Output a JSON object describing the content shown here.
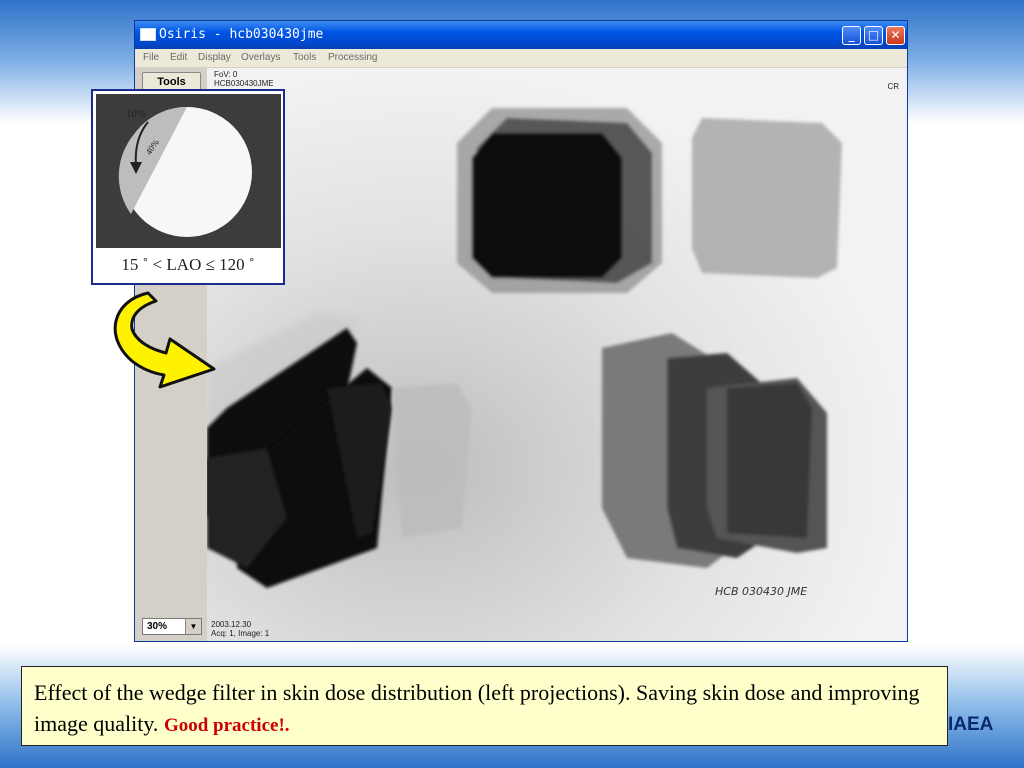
{
  "window": {
    "title": "Osiris - hcb030430jme",
    "menu": [
      "File",
      "Edit",
      "Display",
      "Overlays",
      "Tools",
      "Processing"
    ],
    "tools_label": "Tools",
    "zoom": "30%"
  },
  "viewer": {
    "top_left_lines": [
      "FoV: 0",
      "HCB030430JME"
    ],
    "top_right": "CR",
    "bottom_left_lines": [
      "2003.12.30",
      "Acq: 1, Image: 1"
    ],
    "handwriting": "HCB 030430 JME"
  },
  "inset": {
    "label_10": "10%",
    "label_40": "40%",
    "caption": "15 ˚ < LAO ≤ 120 ˚"
  },
  "caption": {
    "text": "Effect of the wedge filter in skin dose distribution (left projections). Saving skin dose and improving image quality. ",
    "highlight": "Good practice!."
  },
  "logo": "IAEA",
  "colors": {
    "titlebar": "#0055e5",
    "caption_bg": "#ffffcc",
    "highlight": "#cc0000",
    "arrow": "#ffee00"
  }
}
